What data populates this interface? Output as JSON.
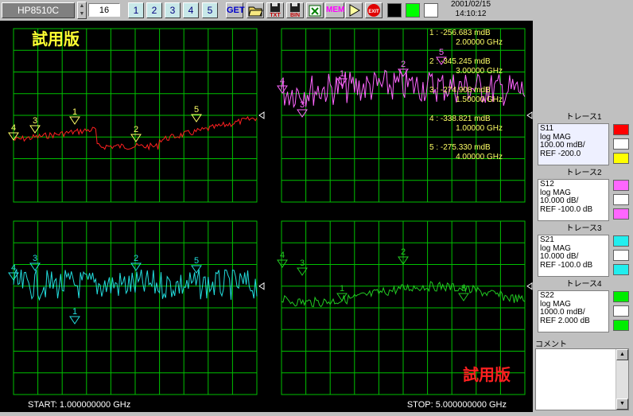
{
  "toolbar": {
    "instrument": "HP8510C",
    "number": "16",
    "num_buttons": [
      "1",
      "2",
      "3",
      "4",
      "5"
    ],
    "get_label": "GET",
    "mem_label": "MEM",
    "txt_label": "TXT",
    "bin_label": "BIN",
    "swatch_colors": [
      "#000000",
      "#00ff00",
      "#ffffff"
    ],
    "date": "2001/02/15",
    "time": "14:10:12"
  },
  "screen": {
    "watermark": "試用版",
    "start_label": "START: 1.000000000 GHz",
    "stop_label": "STOP: 5.000000000 GHz",
    "colors": {
      "grid": "#00c000",
      "trace1": "#ff2020",
      "trace2": "#ff66ff",
      "trace3": "#22dddd",
      "trace4": "#22cc22",
      "marker_text": "#ffff66"
    }
  },
  "markers": [
    {
      "num": "1",
      "value": "-256.683 mdB",
      "freq": "2.00000 GHz"
    },
    {
      "num": "2",
      "value": "-345.245 mdB",
      "freq": "3.00000 GHz"
    },
    {
      "num": "3",
      "value": "-274.908 mdB",
      "freq": "1.50000 GHz"
    },
    {
      "num": "4",
      "value": "-338.821 mdB",
      "freq": "1.00000 GHz"
    },
    {
      "num": "5",
      "value": "-275.330 mdB",
      "freq": "4.00000 GHz"
    }
  ],
  "traces": [
    {
      "title": "トレース1",
      "param": "S11",
      "format": "log MAG",
      "scale": "100.00 mdB/",
      "ref": "REF -200.0",
      "colors": [
        "#ff0000",
        "#ffffff",
        "#ffff00"
      ]
    },
    {
      "title": "トレース2",
      "param": "S12",
      "format": "log MAG",
      "scale": "10.000 dB/",
      "ref": "REF -100.0 dB",
      "colors": [
        "#ff66ff",
        "#ffffff",
        "#ff66ff"
      ]
    },
    {
      "title": "トレース3",
      "param": "S21",
      "format": "log MAG",
      "scale": "10.000 dB/",
      "ref": "REF -100.0 dB",
      "colors": [
        "#22eeee",
        "#ffffff",
        "#22eeee"
      ]
    },
    {
      "title": "トレース4",
      "param": "S22",
      "format": "log MAG",
      "scale": "1000.0 mdB/",
      "ref": "REF 2.000 dB",
      "colors": [
        "#00ee00",
        "#ffffff",
        "#00ee00"
      ]
    }
  ],
  "comment": {
    "title": "コメント",
    "text": ""
  }
}
